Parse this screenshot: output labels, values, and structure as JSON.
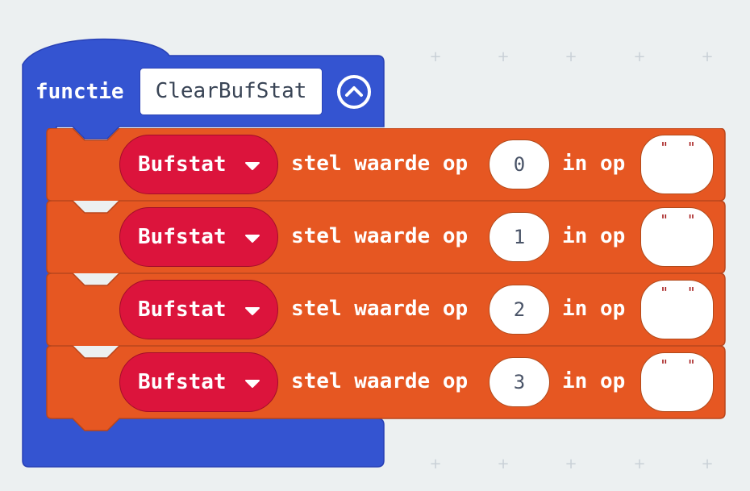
{
  "function_block": {
    "keyword": "functie",
    "name": "ClearBufStat",
    "collapse_icon": "chevron-up-circle-icon",
    "color": "#3454d1"
  },
  "statements": [
    {
      "variable": "Bufstat",
      "action": "stel waarde op",
      "index": "0",
      "preposition": "in op",
      "value": "\" \""
    },
    {
      "variable": "Bufstat",
      "action": "stel waarde op",
      "index": "1",
      "preposition": "in op",
      "value": "\" \""
    },
    {
      "variable": "Bufstat",
      "action": "stel waarde op",
      "index": "2",
      "preposition": "in op",
      "value": "\" \""
    },
    {
      "variable": "Bufstat",
      "action": "stel waarde op",
      "index": "3",
      "preposition": "in op",
      "value": "\" \""
    }
  ],
  "colors": {
    "workspace_background": "#ecf0f1",
    "function_block": "#3454d1",
    "array_block": "#e65722",
    "variable_block": "#dc143c"
  }
}
